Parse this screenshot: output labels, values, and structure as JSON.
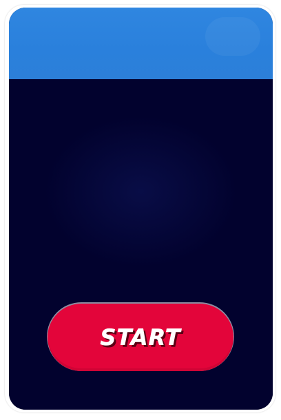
{
  "header": {
    "color": "#2f86e0"
  },
  "play_area": {
    "color": "#02022e"
  },
  "start_button": {
    "label": "START",
    "color": "#e3053a"
  }
}
